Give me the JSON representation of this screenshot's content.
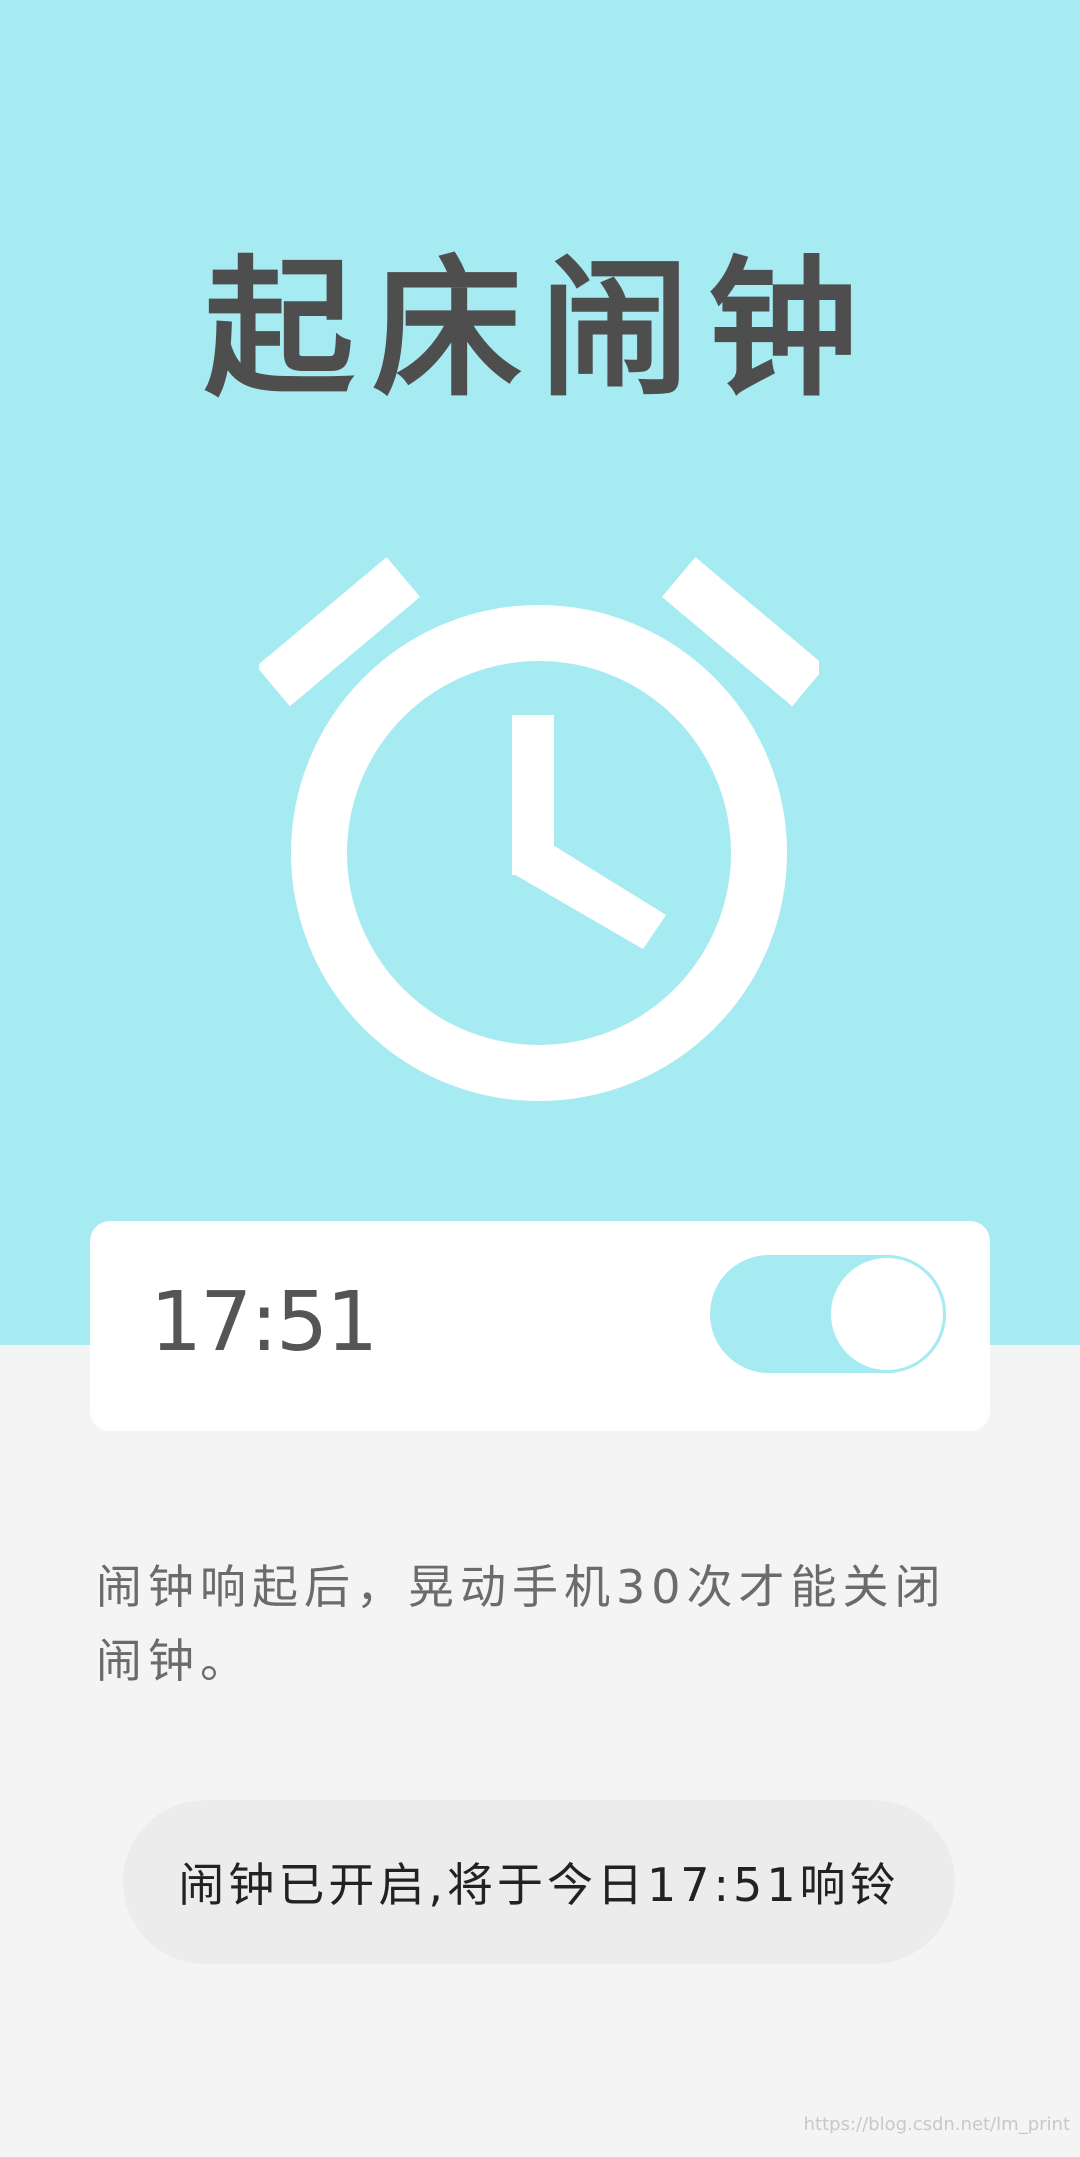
{
  "header": {
    "title": "起床闹钟"
  },
  "hero": {
    "icon": "alarm-clock-icon"
  },
  "alarm": {
    "time": "17:51",
    "enabled": true
  },
  "hint": {
    "text": "闹钟响起后，晃动手机30次才能关闭闹钟。"
  },
  "status": {
    "text": "闹钟已开启,将于今日17:51响铃"
  },
  "watermark": {
    "text": "https://blog.csdn.net/lm_print"
  },
  "colors": {
    "accent": "#a6eaf2",
    "background": "#f4f4f4",
    "card": "#ffffff",
    "title_text": "#4e4e4e",
    "pill": "#ececec"
  }
}
